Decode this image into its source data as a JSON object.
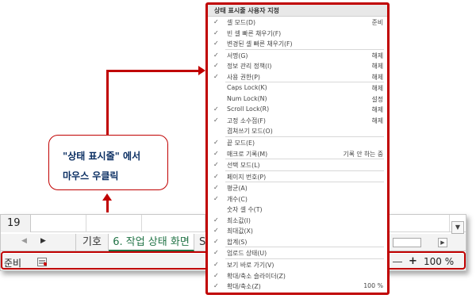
{
  "excel": {
    "row_number": "19",
    "sheet_tabs": [
      "기호",
      "6. 작업 상태 화면",
      "S"
    ],
    "status_ready": "준비",
    "zoom_level": "100 %",
    "zoom_plus": "+"
  },
  "callout": {
    "line1": "\"상태 표시줄\" 에서",
    "line2": "마우스 우클릭"
  },
  "menu": {
    "header": "상태 표시줄 사용자 지정",
    "items": [
      {
        "checked": true,
        "label": "셀 모드(D)",
        "value": "준비"
      },
      {
        "checked": true,
        "label": "빈 셀 빠른 채우기(F)",
        "value": ""
      },
      {
        "checked": true,
        "label": "변경된 셀 빠른 채우기(F)",
        "value": ""
      },
      {
        "checked": true,
        "label": "서명(G)",
        "value": "해제"
      },
      {
        "checked": true,
        "label": "정보 관리 정책(I)",
        "value": "해제"
      },
      {
        "checked": true,
        "label": "사용 권한(P)",
        "value": "해제"
      },
      {
        "checked": false,
        "label": "Caps Lock(K)",
        "value": "해제"
      },
      {
        "checked": false,
        "label": "Num Lock(N)",
        "value": "설정"
      },
      {
        "checked": true,
        "label": "Scroll Lock(R)",
        "value": "해제"
      },
      {
        "checked": true,
        "label": "고정 소수점(F)",
        "value": "해제"
      },
      {
        "checked": false,
        "label": "겹쳐쓰기 모드(O)",
        "value": ""
      },
      {
        "checked": true,
        "label": "끝 모드(E)",
        "value": ""
      },
      {
        "checked": true,
        "label": "매크로 기록(M)",
        "value": "기록 안 하는 중"
      },
      {
        "checked": true,
        "label": "선택 모드(L)",
        "value": ""
      },
      {
        "checked": true,
        "label": "페이지 번호(P)",
        "value": ""
      },
      {
        "checked": true,
        "label": "평균(A)",
        "value": ""
      },
      {
        "checked": true,
        "label": "개수(C)",
        "value": ""
      },
      {
        "checked": false,
        "label": "숫자 셀 수(T)",
        "value": ""
      },
      {
        "checked": true,
        "label": "최소값(I)",
        "value": ""
      },
      {
        "checked": true,
        "label": "최대값(X)",
        "value": ""
      },
      {
        "checked": true,
        "label": "합계(S)",
        "value": ""
      },
      {
        "checked": true,
        "label": "업로드 상태(U)",
        "value": ""
      },
      {
        "checked": true,
        "label": "보기 바로 가기(V)",
        "value": ""
      },
      {
        "checked": true,
        "label": "확대/축소 슬라이더(Z)",
        "value": ""
      },
      {
        "checked": true,
        "label": "확대/축소(Z)",
        "value": "100 %"
      }
    ]
  },
  "colors": {
    "highlight_red": "#c00000",
    "callout_text": "#0b2f63",
    "active_tab": "#217346"
  }
}
